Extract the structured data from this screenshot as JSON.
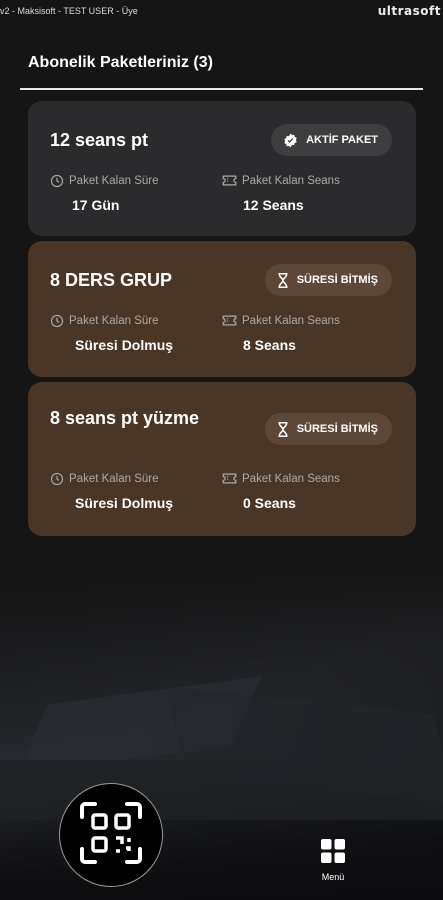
{
  "status_bar": {
    "left_text": "v2 - Maksisoft - TEST USER - Üye",
    "brand": "ultrasoft"
  },
  "page": {
    "title": "Abonelik Paketleriniz (3)"
  },
  "cards": [
    {
      "title": "12 seans pt",
      "badge": "AKTİF PAKET",
      "time_label": "Paket Kalan Süre",
      "time_value": "17 Gün",
      "sessions_label": "Paket Kalan Seans",
      "sessions_value": "12 Seans"
    },
    {
      "title": "8 DERS GRUP",
      "badge": "SÜRESİ BİTMİŞ",
      "time_label": "Paket Kalan Süre",
      "time_value": "Süresi Dolmuş",
      "sessions_label": "Paket Kalan Seans",
      "sessions_value": "8 Seans"
    },
    {
      "title": "8 seans pt yüzme",
      "badge": "SÜRESİ BİTMİŞ",
      "time_label": "Paket Kalan Süre",
      "time_value": "Süresi Dolmuş",
      "sessions_label": "Paket Kalan Seans",
      "sessions_value": "0 Seans"
    }
  ],
  "bottom_nav": {
    "menu_label": "Menü"
  },
  "icons": {
    "qr": "qr-scan-icon",
    "menu": "grid-menu-icon",
    "clock": "clock-icon",
    "ticket": "ticket-icon",
    "verified": "verified-badge-icon",
    "hourglass": "hourglass-icon"
  },
  "colors": {
    "background": "#151515",
    "active_card": "#2b2b2d",
    "expired_card": "#4a3627",
    "label_gray": "#a9a9a9"
  }
}
